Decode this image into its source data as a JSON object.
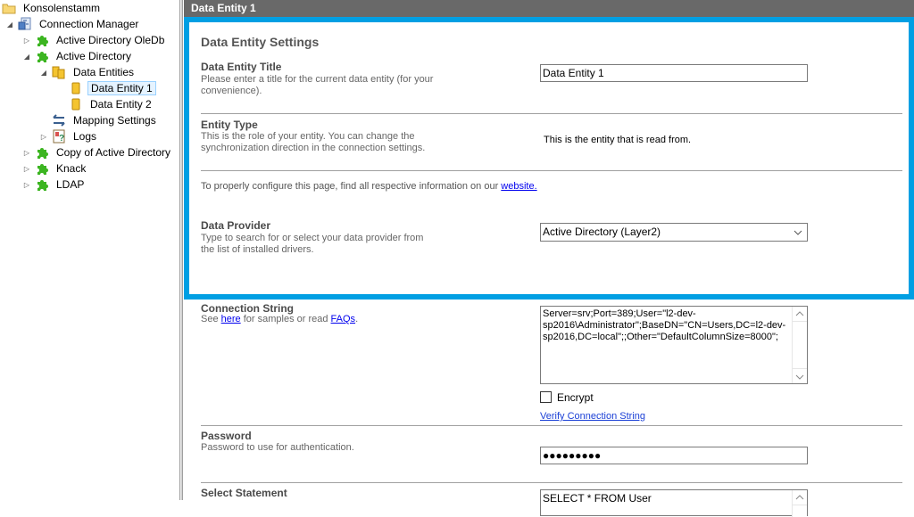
{
  "tree": {
    "items": [
      {
        "label": "Konsolenstamm",
        "icon": "folder-icon",
        "expander": "none",
        "level": 0
      },
      {
        "label": "Connection Manager",
        "icon": "connection-manager-icon",
        "expander": "expanded",
        "level": 1
      },
      {
        "label": "Active Directory OleDb",
        "icon": "puzzle-icon",
        "expander": "collapsed",
        "level": 2
      },
      {
        "label": "Active Directory",
        "icon": "puzzle-icon",
        "expander": "expanded",
        "level": 2
      },
      {
        "label": "Data Entities",
        "icon": "database-group-icon",
        "expander": "expanded",
        "level": 3
      },
      {
        "label": "Data Entity 1",
        "icon": "database-icon",
        "expander": "none",
        "level": 4,
        "selected": true
      },
      {
        "label": "Data Entity 2",
        "icon": "database-icon",
        "expander": "none",
        "level": 4
      },
      {
        "label": "Mapping Settings",
        "icon": "mapping-arrows-icon",
        "expander": "none",
        "level": 3
      },
      {
        "label": "Logs",
        "icon": "log-icon",
        "expander": "collapsed",
        "level": 3
      },
      {
        "label": "Copy of Active Directory",
        "icon": "puzzle-icon",
        "expander": "collapsed",
        "level": 2
      },
      {
        "label": "Knack",
        "icon": "puzzle-icon",
        "expander": "collapsed",
        "level": 2
      },
      {
        "label": "LDAP",
        "icon": "puzzle-icon",
        "expander": "collapsed",
        "level": 2
      }
    ]
  },
  "header": {
    "title": "Data Entity 1"
  },
  "settings": {
    "section_title": "Data Entity Settings",
    "title_field": {
      "label": "Data Entity Title",
      "description": "Please enter a title for the current data entity (for your convenience).",
      "value": "Data Entity 1"
    },
    "entity_type": {
      "label": "Entity Type",
      "description": "This is the role of your entity. You can change the synchronization direction in the connection settings.",
      "value": "This is the entity that is read from."
    },
    "info": {
      "text": "To properly configure this page, find all respective information on our ",
      "link": "website."
    },
    "data_provider": {
      "label": "Data Provider",
      "description": "Type to search for or select your data provider from the list of installed drivers.",
      "selected": "Active Directory (Layer2)"
    },
    "connection_string": {
      "label": "Connection String",
      "desc_prefix": "See ",
      "desc_link1": "here",
      "desc_middle": " for samples or read ",
      "desc_link2": "FAQs",
      "desc_suffix": ".",
      "value": "Server=srv;Port=389;User=\"l2-dev-sp2016\\Administrator\";BaseDN=\"CN=Users,DC=l2-dev-sp2016,DC=local\";;Other=\"DefaultColumnSize=8000\";",
      "encrypt_label": "Encrypt",
      "encrypt_checked": false,
      "verify_link": "Verify Connection String"
    },
    "password": {
      "label": "Password",
      "description": "Password to use for authentication.",
      "masked_value": "●●●●●●●●●"
    },
    "select_statement": {
      "label": "Select Statement",
      "value": "SELECT * FROM User"
    }
  },
  "colors": {
    "highlight": "#009fe3",
    "header_bg": "#696969",
    "puzzle_green": "#3cb521",
    "link": "#0000ee"
  }
}
